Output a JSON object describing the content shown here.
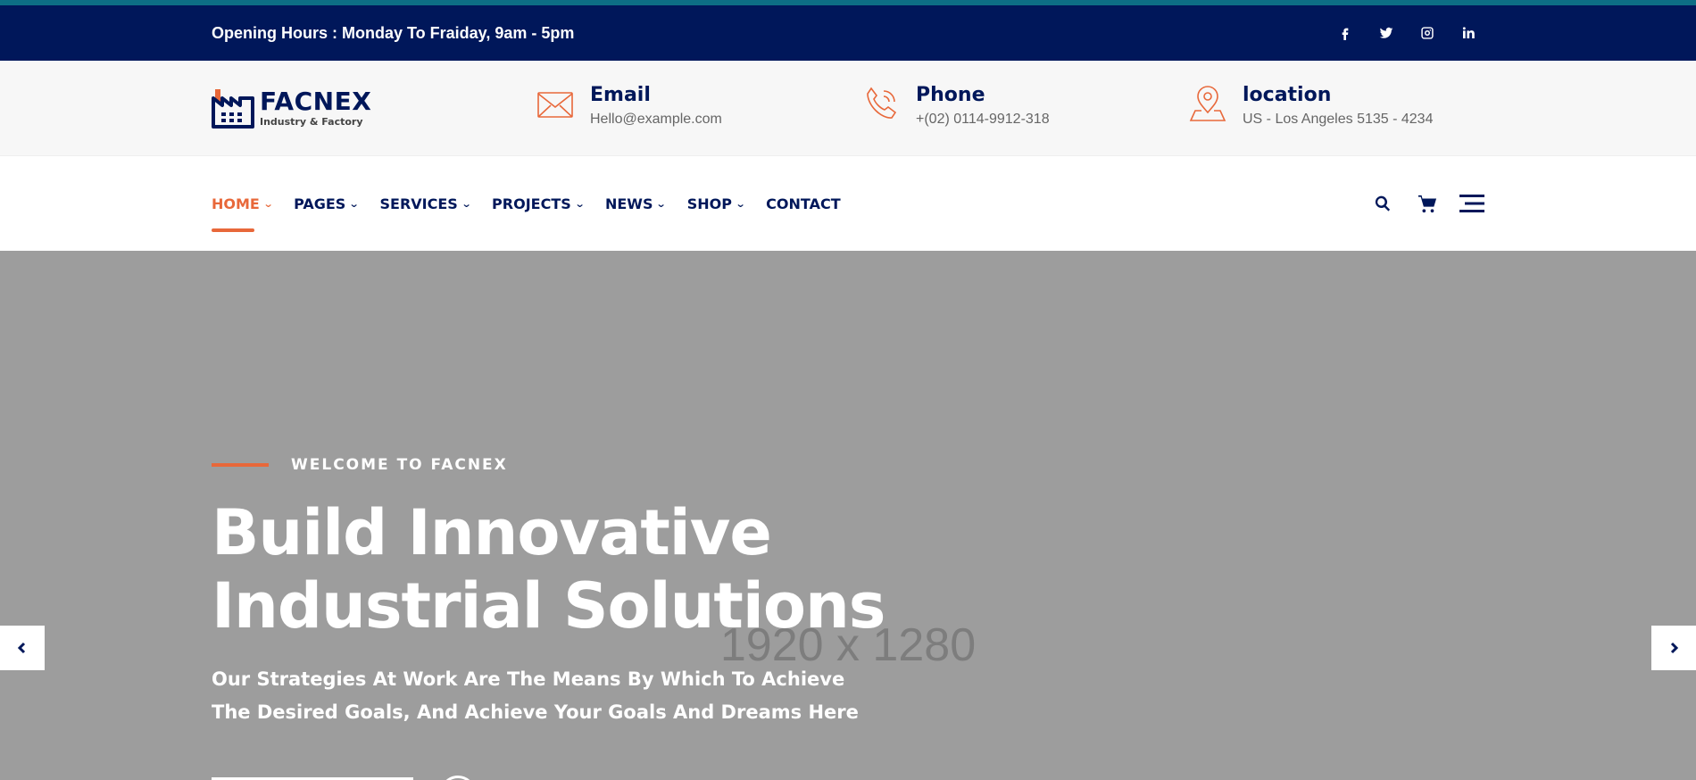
{
  "colors": {
    "accent": "#e8683a",
    "navy": "#00175a",
    "teal": "#0d6e85",
    "hero_bg": "#9d9d9d"
  },
  "topbar": {
    "hours": "Opening Hours : Monday To Fraiday, 9am - 5pm",
    "socials": [
      "facebook-icon",
      "twitter-icon",
      "instagram-icon",
      "linkedin-icon"
    ]
  },
  "brand": {
    "name": "FACNEX",
    "tagline": "Industry & Factory"
  },
  "contact": {
    "email": {
      "title": "Email",
      "value": "Hello@example.com",
      "icon": "envelope-icon"
    },
    "phone": {
      "title": "Phone",
      "value": "+(02) 0114-9912-318",
      "icon": "phone-icon"
    },
    "location": {
      "title": "location",
      "value": "US - Los Angeles 5135 - 4234",
      "icon": "map-pin-icon"
    }
  },
  "nav": {
    "items": [
      {
        "label": "HOME",
        "dropdown": true,
        "active": true
      },
      {
        "label": "PAGES",
        "dropdown": true
      },
      {
        "label": "SERVICES",
        "dropdown": true
      },
      {
        "label": "PROJECTS",
        "dropdown": true
      },
      {
        "label": "NEWS",
        "dropdown": true
      },
      {
        "label": "SHOP",
        "dropdown": true
      },
      {
        "label": "CONTACT",
        "dropdown": false
      }
    ],
    "tools": [
      "search-icon",
      "cart-icon",
      "menu-icon"
    ]
  },
  "hero": {
    "eyebrow": "WELCOME TO FACNEX",
    "headline_line1": "Build Innovative",
    "headline_line2": "Industrial Solutions",
    "subtitle": "Our Strategies At Work Are The Means By Which To Achieve The Desired Goals, And Achieve Your Goals And Dreams Here",
    "placeholder": "1920 x 1280"
  }
}
